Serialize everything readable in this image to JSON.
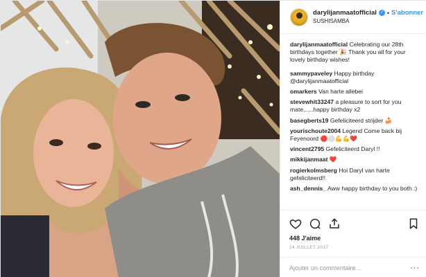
{
  "post": {
    "username": "darylijanmaatofficial",
    "follow_label": "S'abonner",
    "location": "SUSHISAMBA",
    "likes": "448 J'aime",
    "date": "24 JUILLET 2017",
    "add_comment_placeholder": "Ajouter un commentaire…",
    "more": "···"
  },
  "comments": [
    {
      "user": "darylijanmaatofficial",
      "text": "Celebrating our 28th birthdays together 🎉 Thank you all for your lovely birthday wishes!"
    },
    {
      "user": "sammypaveley",
      "text": "Happy birthday @darylijanmaatofficial"
    },
    {
      "user": "omarkers",
      "text": "Van harte allebei"
    },
    {
      "user": "stevewhit33247",
      "text": "a pleasure to sort for you mate......happy birthday x2"
    },
    {
      "user": "basegberts19",
      "text": "Gefeliciteerd strijder 🍰"
    },
    {
      "user": "yourischoute2004",
      "text": "Legend Come back bij Feyenoord 🔴⚪💪💪❤️"
    },
    {
      "user": "vincent2795",
      "text": "Gefeliciteerd Daryl !!"
    },
    {
      "user": "mikkijanmaat",
      "text": "❤️"
    },
    {
      "user": "rogierkolmsberg",
      "text": "Hoi Daryl van harte gefeliciteerd!!"
    },
    {
      "user": "ash_dennis_",
      "text": "Aww happy birthday to you both :)"
    }
  ],
  "icons": [
    "heart-icon",
    "comment-icon",
    "share-icon",
    "bookmark-icon"
  ],
  "colors": {
    "link": "#3897f0",
    "text": "#262626",
    "muted": "#999999",
    "heart": "#ed4956"
  }
}
